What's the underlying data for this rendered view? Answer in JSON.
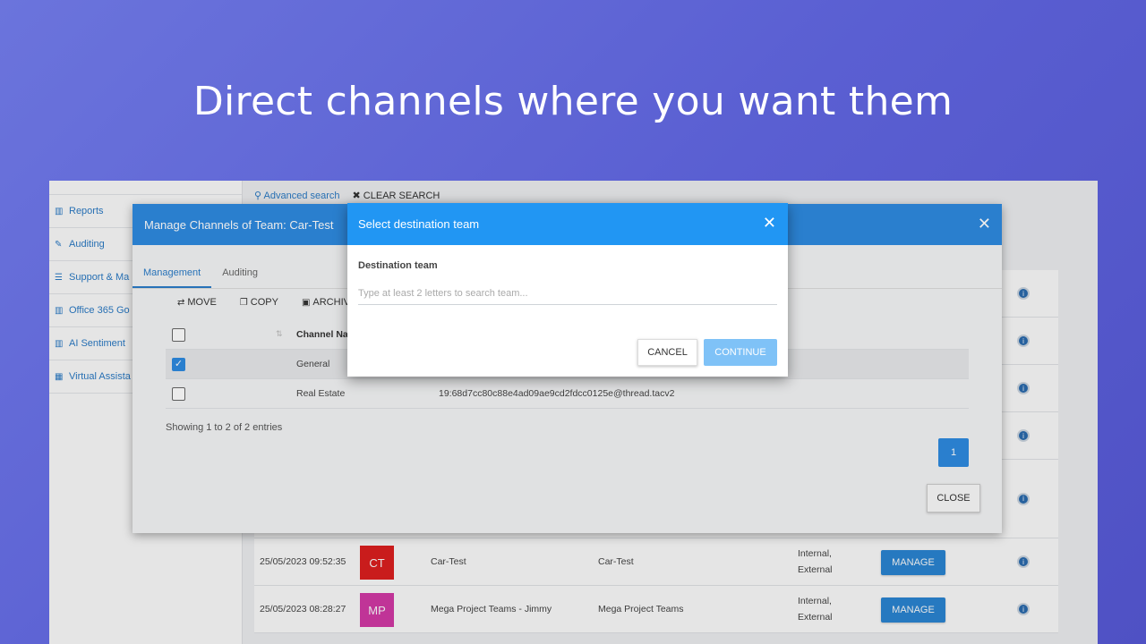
{
  "headline": "Direct channels where you want them",
  "sidebar": {
    "items": [
      {
        "icon": "bar-chart-icon",
        "glyph": "▥",
        "label": "Reports"
      },
      {
        "icon": "edit-icon",
        "glyph": "✎",
        "label": "Auditing"
      },
      {
        "icon": "list-icon",
        "glyph": "☰",
        "label": "Support & Ma"
      },
      {
        "icon": "bar-chart-icon",
        "glyph": "▥",
        "label": "Office 365 Go"
      },
      {
        "icon": "bar-chart-icon",
        "glyph": "▥",
        "label": "AI Sentiment"
      },
      {
        "icon": "calendar-icon",
        "glyph": "▦",
        "label": "Virtual Assista"
      }
    ]
  },
  "searchbar": {
    "advanced": "Advanced search",
    "clear": "CLEAR SEARCH"
  },
  "bg_rows": [
    {
      "date": "25/05/2023 09:52:35",
      "initials": "CT",
      "avatar_color": "#e02020",
      "name": "Car-Test",
      "team": "Car-Test",
      "type1": "Internal,",
      "type2": "External",
      "manage": "MANAGE"
    },
    {
      "date": "25/05/2023 08:28:27",
      "initials": "MP",
      "avatar_color": "#d63aa9",
      "name": "Mega Project Teams - Jimmy",
      "team": "Mega Project Teams",
      "type1": "Internal,",
      "type2": "External",
      "manage": "MANAGE"
    }
  ],
  "manage_modal": {
    "title": "Manage Channels of Team: Car-Test",
    "tabs": [
      "Management",
      "Auditing"
    ],
    "actions": [
      "MOVE",
      "COPY",
      "ARCHIV"
    ],
    "column_header": "Channel Na",
    "channels": [
      {
        "name": "General",
        "id": "",
        "checked": true
      },
      {
        "name": "Real Estate",
        "id": "19:68d7cc80c88e4ad09ae9cd2fdcc0125e@thread.tacv2",
        "checked": false
      }
    ],
    "showing": "Showing 1 to 2 of 2 entries",
    "page": "1",
    "close": "CLOSE"
  },
  "dest_modal": {
    "title": "Select destination team",
    "label": "Destination team",
    "placeholder": "Type at least 2 letters to search team...",
    "cancel": "CANCEL",
    "continue": "CONTINUE"
  }
}
